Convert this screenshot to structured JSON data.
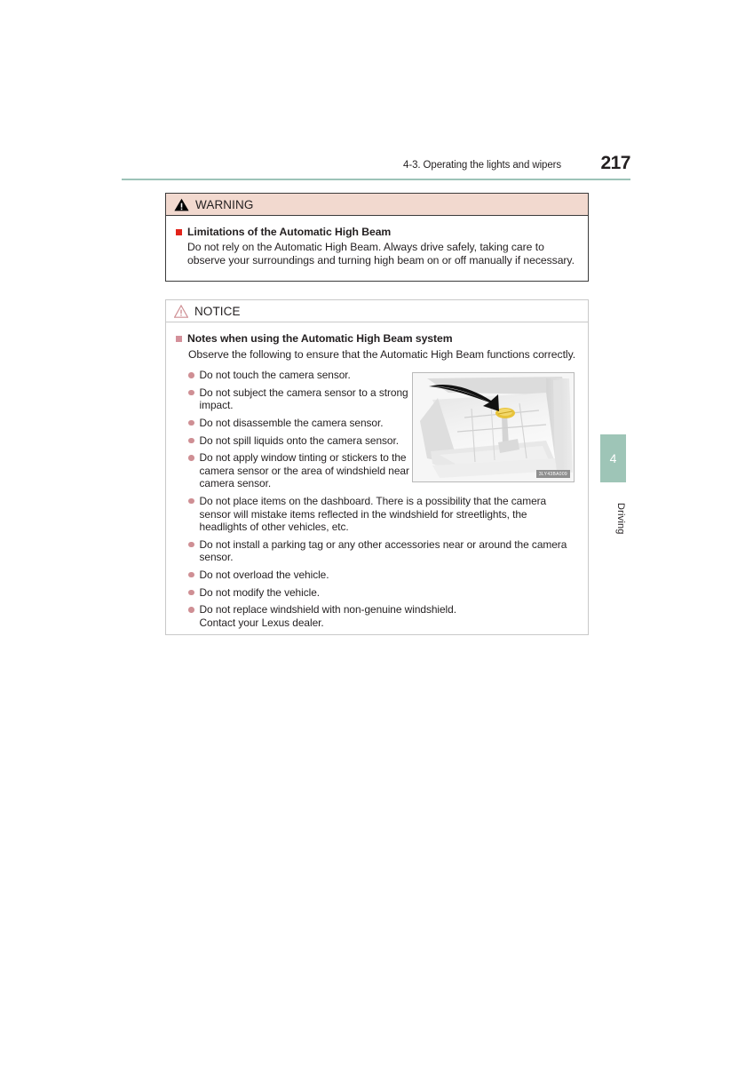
{
  "header": {
    "section_title": "4-3. Operating the lights and wipers",
    "page_number": "217",
    "rule_color": "#9dc3b8"
  },
  "warning_box": {
    "label": "WARNING",
    "icon": "warning-triangle-solid-icon",
    "header_bg": "#f2d9cf",
    "bullet_color": "#e2231a",
    "heading": "Limitations of the Automatic High Beam",
    "paragraph": "Do not rely on the Automatic High Beam. Always drive safely, taking care to observe your surroundings and turning high beam on or off manually if necessary."
  },
  "notice_box": {
    "label": "NOTICE",
    "icon": "notice-triangle-outline-icon",
    "icon_color": "#cf8f94",
    "bullet_color": "#d4909a",
    "heading": "Notes when using the Automatic High Beam system",
    "paragraph": "Observe the following to ensure that the Automatic High Beam functions correctly.",
    "items": [
      {
        "text": "Do not touch the camera sensor.",
        "narrow": true
      },
      {
        "text": "Do not subject the camera sensor to a strong impact.",
        "narrow": true
      },
      {
        "text": "Do not disassemble the camera sensor.",
        "narrow": true
      },
      {
        "text": "Do not spill liquids onto the camera sensor.",
        "narrow": true
      },
      {
        "text": "Do not apply window tinting or stickers to the camera sensor or the area of windshield near the camera sensor.",
        "narrow": true
      },
      {
        "text": "Do not place items on the dashboard. There is a possibility that the camera sensor will mistake items reflected in the windshield for streetlights, the headlights of other vehicles, etc.",
        "narrow": false
      },
      {
        "text": "Do not install a parking tag or any other accessories near or around the camera sensor.",
        "narrow": false
      },
      {
        "text": "Do not overload the vehicle.",
        "narrow": false
      },
      {
        "text": "Do not modify the vehicle.",
        "narrow": false
      },
      {
        "text": "Do not replace windshield with non-genuine windshield.\nContact your Lexus dealer.",
        "narrow": false
      }
    ]
  },
  "figure": {
    "caption_code": "3LY43BA009",
    "alt_name": "windshield-camera-sensor-illustration",
    "highlight_color": "#e8c33a"
  },
  "thumb_tab": {
    "chapter_number": "4",
    "chapter_label": "Driving",
    "color": "#9ec5b7"
  }
}
